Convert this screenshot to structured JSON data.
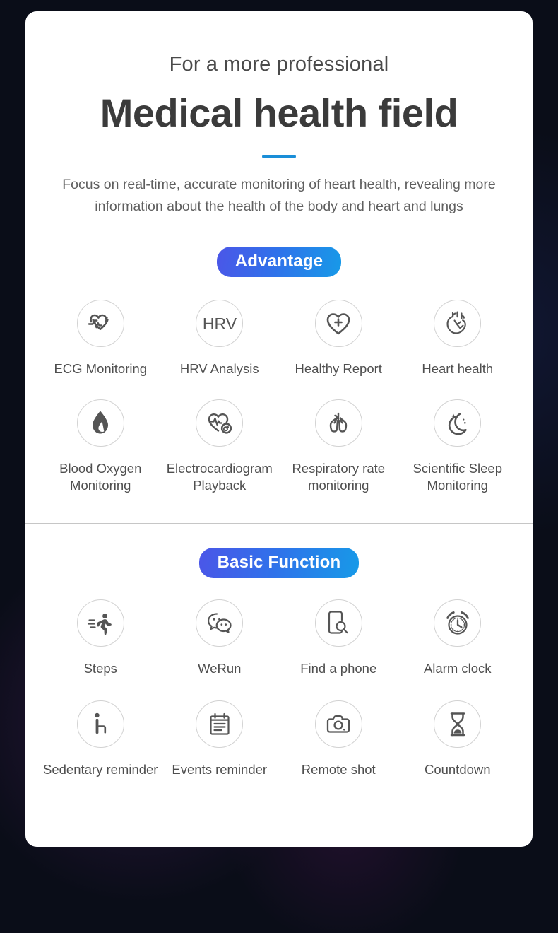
{
  "theme": {
    "card_background": "#ffffff",
    "page_background": "#0a0d18",
    "accent_bar_color": "#1a8ed8",
    "badge_gradient_start": "#4b56e8",
    "badge_gradient_end": "#179ae8",
    "icon_stroke": "#555555",
    "icon_circle_border": "#d2d2d2",
    "divider_color": "#c6c6c6"
  },
  "header": {
    "eyebrow": "For a more professional",
    "headline": "Medical health field",
    "subtitle": "Focus on real-time, accurate monitoring of heart health, revealing more information about the health of the body and heart and lungs"
  },
  "sections": [
    {
      "badge": "Advantage",
      "features": [
        {
          "label": "ECG Monitoring",
          "icon": "heart-ecg-icon"
        },
        {
          "label": "HRV Analysis",
          "icon": "hrv-text-icon"
        },
        {
          "label": "Healthy Report",
          "icon": "heart-plus-icon"
        },
        {
          "label": "Heart health",
          "icon": "anatomical-heart-icon"
        },
        {
          "label": "Blood Oxygen Monitoring",
          "icon": "blood-drop-icon"
        },
        {
          "label": "Electrocardiogram Playback",
          "icon": "heart-waveform-replay-icon"
        },
        {
          "label": "Respiratory rate monitoring",
          "icon": "lungs-icon"
        },
        {
          "label": "Scientific Sleep Monitoring",
          "icon": "moon-stars-icon"
        }
      ]
    },
    {
      "badge": "Basic Function",
      "features": [
        {
          "label": "Steps",
          "icon": "running-person-icon"
        },
        {
          "label": "WeRun",
          "icon": "chat-bubbles-icon"
        },
        {
          "label": "Find a phone",
          "icon": "phone-search-icon"
        },
        {
          "label": "Alarm clock",
          "icon": "alarm-clock-icon"
        },
        {
          "label": "Sedentary reminder",
          "icon": "sitting-person-icon"
        },
        {
          "label": "Events reminder",
          "icon": "notepad-icon"
        },
        {
          "label": "Remote shot",
          "icon": "camera-icon"
        },
        {
          "label": "Countdown",
          "icon": "hourglass-icon"
        }
      ]
    }
  ]
}
